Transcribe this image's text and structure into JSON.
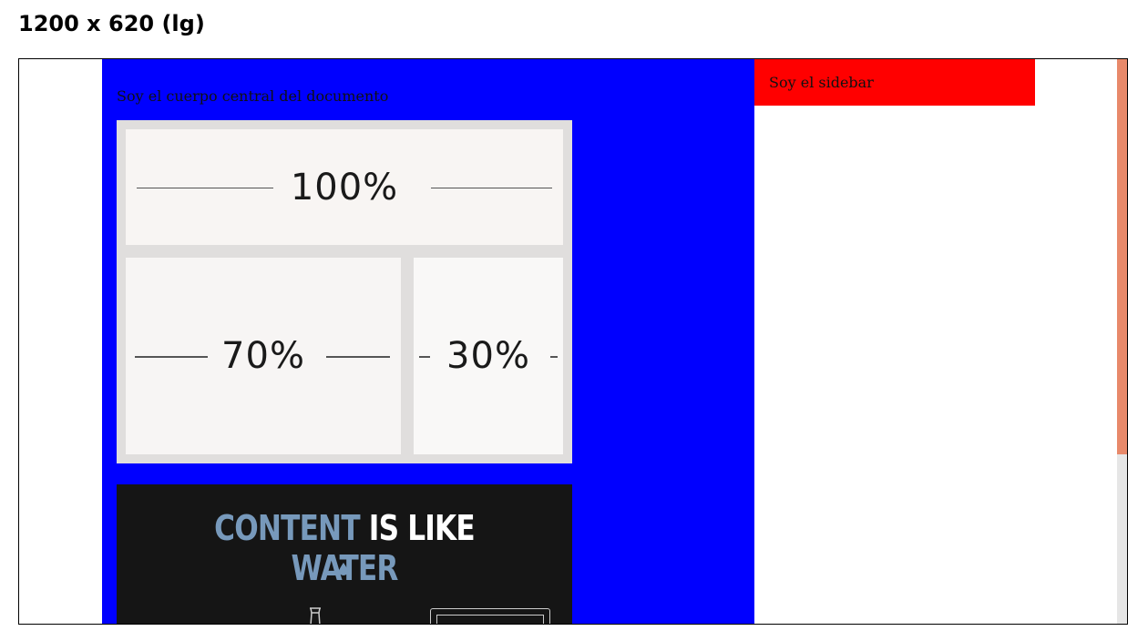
{
  "frame": {
    "title": "1200 x 620 (lg)"
  },
  "main": {
    "text": "Soy el cuerpo central del documento",
    "grid_image": {
      "top_label": "100%",
      "left_label": "70%",
      "right_label": "30%"
    },
    "water_image": {
      "word1": "CONTENT",
      "word2": "IS LIKE",
      "word3": "WATER"
    },
    "bg_color": "#0000ff"
  },
  "sidebar": {
    "text": "Soy el sidebar",
    "bg_color": "#ff0000"
  },
  "scrollbar": {
    "thumb_color": "#e8896a",
    "position_fraction": 0.0
  }
}
